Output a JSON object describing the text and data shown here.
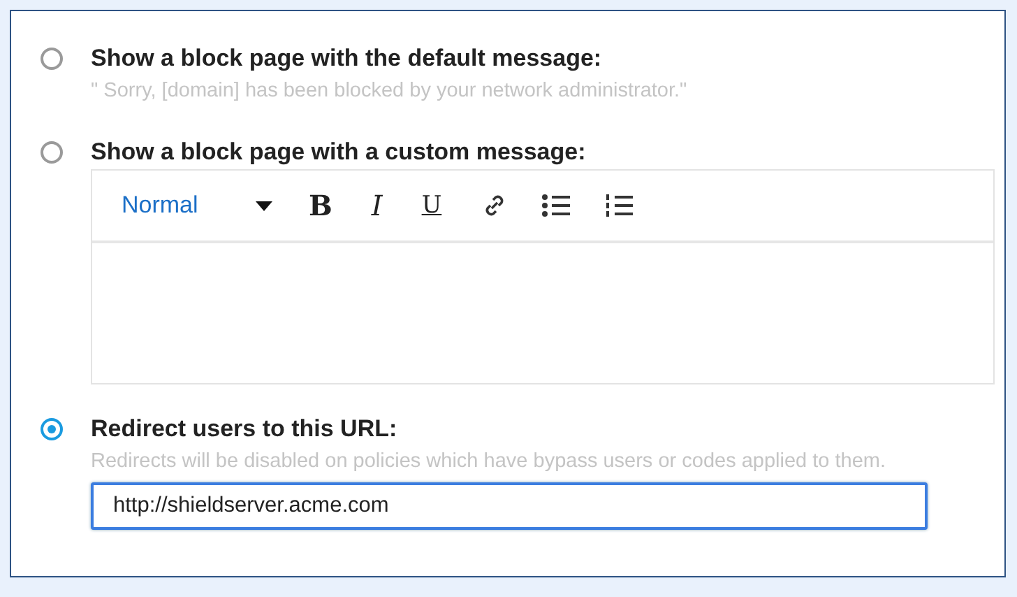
{
  "options": [
    {
      "kind": "plain",
      "selected": false,
      "title": "Show a block page with the default message:",
      "description": "\" Sorry, [domain] has been blocked by your network administrator.\""
    },
    {
      "kind": "editor",
      "selected": false,
      "title": "Show a block page with a custom message:",
      "editor": {
        "format": "Normal",
        "buttons": [
          {
            "kind": "bold",
            "label": "B"
          },
          {
            "kind": "italic",
            "label": "I"
          },
          {
            "kind": "underline",
            "label": "U"
          },
          {
            "kind": "link"
          },
          {
            "kind": "bullets"
          },
          {
            "kind": "numbers"
          }
        ]
      }
    },
    {
      "kind": "url",
      "selected": true,
      "title": "Redirect users to this URL:",
      "description": "Redirects will be disabled on policies which have bypass users or codes applied to them.",
      "value": "http://shieldserver.acme.com"
    }
  ]
}
